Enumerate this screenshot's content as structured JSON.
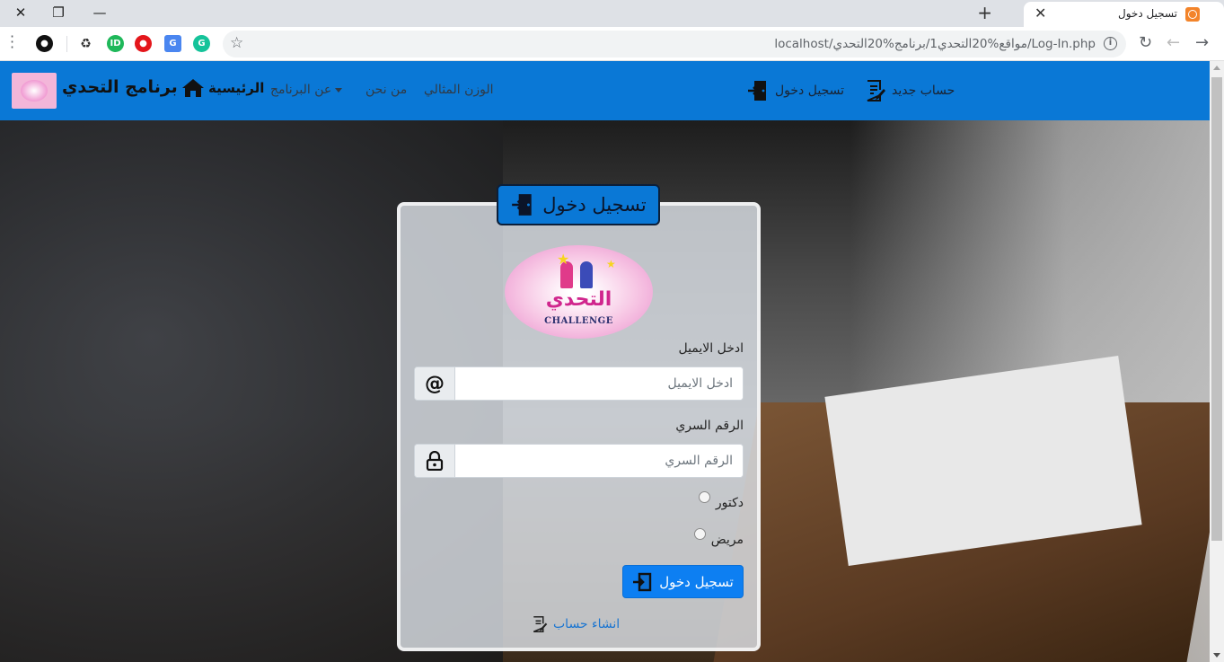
{
  "browser": {
    "tab_title": "تسجيل دخول",
    "url": "localhost/مواقع%20التحدي1/برنامج%20التحدي/Log-In.php"
  },
  "navbar": {
    "brand": "برنامج التحدي",
    "home": "الرئيسية",
    "about": "عن البرنامج",
    "who": "من نحن",
    "ideal_weight": "الوزن المثالي",
    "login": "تسجيل دخول",
    "new_account": "حساب جديد"
  },
  "card": {
    "header": "تسجيل دخول",
    "logo_text": "التحدي",
    "logo_sub": "CHALLENGE",
    "email_label": "ادخل الايميل",
    "email_placeholder": "ادخل الايميل",
    "password_label": "الرقم السري",
    "password_placeholder": "الرقم السري",
    "radio_doctor": "دكتور",
    "radio_patient": "مريض",
    "submit": "تسجيل دخول",
    "signup": "انشاء حساب"
  },
  "colors": {
    "navbar": "#0a78d6",
    "primary_button": "#0d7ff2",
    "link": "#1a75d1"
  }
}
